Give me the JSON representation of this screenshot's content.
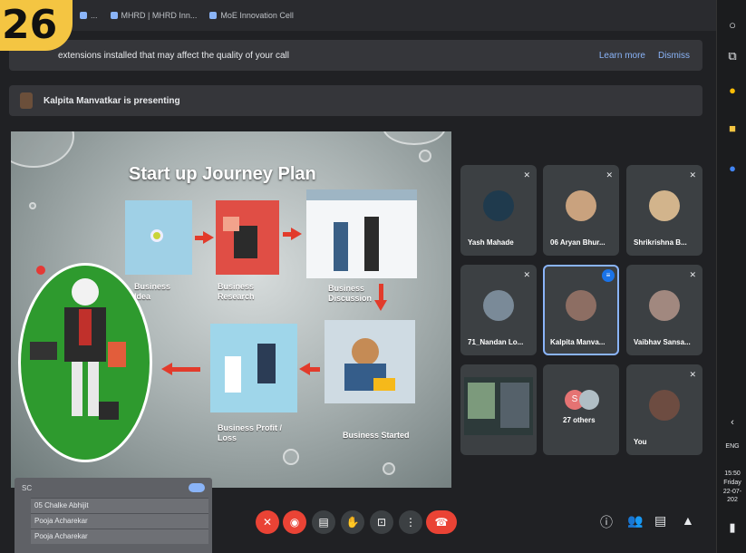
{
  "overlay_badge": "26",
  "bookmarks": [
    {
      "label": "..."
    },
    {
      "label": "MHRD | MHRD Inn..."
    },
    {
      "label": "MoE Innovation Cell"
    }
  ],
  "notice": {
    "text": "extensions installed that may affect the quality of your call",
    "learn_more": "Learn more",
    "dismiss": "Dismiss"
  },
  "presenter": {
    "text": "Kalpita Manvatkar is presenting"
  },
  "slide": {
    "title": "Start up Journey Plan",
    "steps": [
      {
        "label": "Business Idea"
      },
      {
        "label": "Business Research"
      },
      {
        "label": "Business Discussion"
      },
      {
        "label": "Business Started"
      },
      {
        "label": "Business Profit / Loss"
      }
    ]
  },
  "participants": [
    {
      "name": "Yash Mahade",
      "avatar_color": "#1f3a4d"
    },
    {
      "name": "06 Aryan Bhur...",
      "avatar_color": "#c9a27e"
    },
    {
      "name": "Shrikrishna B...",
      "avatar_color": "#d2b48c"
    },
    {
      "name": "71_Nandan Lo...",
      "avatar_color": "#7a8a98"
    },
    {
      "name": "Kalpita Manva...",
      "avatar_color": "#8d6e63",
      "speaking": true
    },
    {
      "name": "Vaibhav Sansa...",
      "avatar_color": "#a1887f"
    },
    {
      "name": "",
      "avatar_color": "#444"
    },
    {
      "name": "27 others",
      "avatar_color": "#e57373"
    },
    {
      "name": "You",
      "avatar_color": "#6d4c41"
    }
  ],
  "others_initial": "S",
  "list_panel": {
    "header": "SC",
    "rows": [
      "05 Chalke Abhijit",
      "Pooja Acharekar",
      "Pooja Acharekar"
    ]
  },
  "taskbar": {
    "lang": "ENG",
    "time": "15:50",
    "day": "Friday",
    "date": "22-07-202"
  },
  "colors": {
    "accent_red": "#ea4335",
    "meet_blue": "#8ab4f8",
    "badge_yellow": "#f4c542"
  }
}
